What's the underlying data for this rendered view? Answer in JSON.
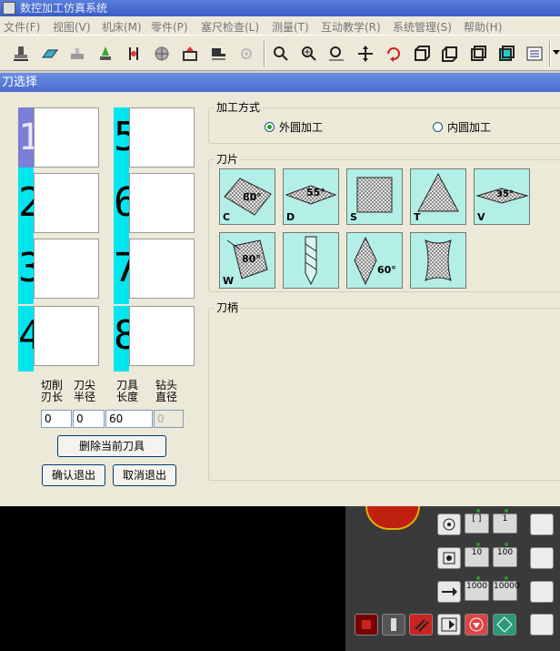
{
  "window": {
    "title": "数控加工仿真系统"
  },
  "menu": [
    "文件(F)",
    "视图(V)",
    "机床(M)",
    "零件(P)",
    "塞尺检查(L)",
    "测量(T)",
    "互动教学(R)",
    "系统管理(S)",
    "帮助(H)"
  ],
  "toolbar": {
    "icons": [
      "machine-select-icon",
      "stock-icon",
      "fixture-icon",
      "tool-select-icon",
      "base-tool-icon",
      "sphere-icon",
      "setup-icon",
      "workpiece-icon",
      "spindle-icon",
      "zoom-icon",
      "zoom-in-icon",
      "zoom-fit-icon",
      "pan-icon",
      "rotate-icon",
      "view-front-icon",
      "view-iso-icon",
      "view-top-icon",
      "view-side-icon",
      "list-icon"
    ]
  },
  "dialog": {
    "title": "刀选择",
    "slots": [
      "1",
      "2",
      "3",
      "4",
      "5",
      "6",
      "7",
      "8"
    ],
    "selected_slot": "1",
    "params": {
      "cut_length_label": "切削\n刃长",
      "tip_radius_label": "刀尖\n半径",
      "tool_length_label": "刀具\n长度",
      "drill_diameter_label": "钻头\n直径",
      "cut_length": "0",
      "tip_radius": "0",
      "tool_length": "60",
      "drill_diameter": "0"
    },
    "delete_button": "删除当前刀具",
    "confirm_button": "确认退出",
    "cancel_button": "取消退出",
    "machining_mode": {
      "title": "加工方式",
      "options": [
        "外圆加工",
        "内圆加工"
      ],
      "selected": "外圆加工"
    },
    "inserts": {
      "title": "刀片",
      "items": [
        {
          "code": "C",
          "angle": "80°"
        },
        {
          "code": "D",
          "angle": "55°"
        },
        {
          "code": "S",
          "angle": ""
        },
        {
          "code": "T",
          "angle": ""
        },
        {
          "code": "V",
          "angle": "35°"
        },
        {
          "code": "W",
          "angle": "80°"
        },
        {
          "code": "",
          "angle": ""
        },
        {
          "code": "",
          "angle": "60°"
        },
        {
          "code": "",
          "angle": ""
        }
      ]
    },
    "holder": {
      "title": "刀柄"
    }
  },
  "control_panel": {
    "keys": [
      "[ ]",
      "1",
      "10",
      "100",
      "1000",
      "10000"
    ]
  }
}
